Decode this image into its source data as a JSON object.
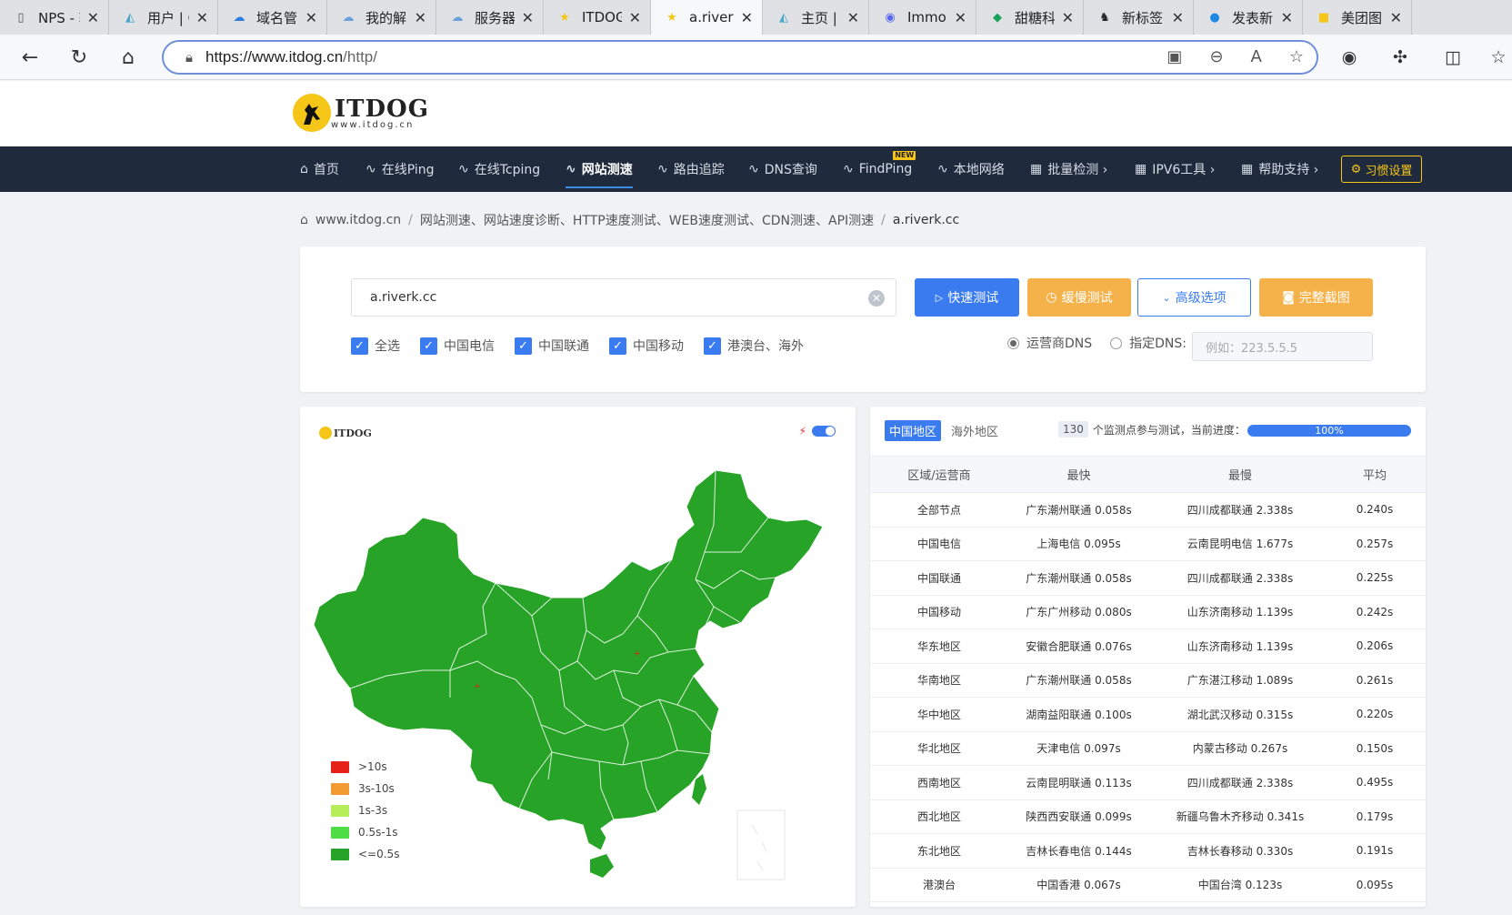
{
  "browser": {
    "tabs": [
      {
        "title": "NPS - 轻",
        "icon": "document-icon",
        "color": "#555"
      },
      {
        "title": "用户 | C",
        "icon": "triangle-icon",
        "color": "#4aa7c9"
      },
      {
        "title": "域名管",
        "icon": "cloud-icon",
        "color": "#2f7de1"
      },
      {
        "title": "我的解",
        "icon": "cloud-icon",
        "color": "#6aa0d8"
      },
      {
        "title": "服务器",
        "icon": "cloud-icon",
        "color": "#6aa0d8"
      },
      {
        "title": "ITDOG",
        "icon": "itdog-icon",
        "color": "#f5c518"
      },
      {
        "title": "a.riverk",
        "icon": "itdog-icon",
        "color": "#f5c518"
      },
      {
        "title": "主页 | A",
        "icon": "triangle-icon",
        "color": "#4aa7c9"
      },
      {
        "title": "Immor",
        "icon": "discord-icon",
        "color": "#5865f2"
      },
      {
        "title": "甜糖科",
        "icon": "sweet-icon",
        "color": "#1aa35a"
      },
      {
        "title": "新标签",
        "icon": "avatar-icon",
        "color": "#222"
      },
      {
        "title": "发表新",
        "icon": "chat-icon",
        "color": "#1e88e5"
      },
      {
        "title": "美团图",
        "icon": "meituan-icon",
        "color": "#f5c518"
      }
    ],
    "url_host": "https://www.itdog.cn",
    "url_path": "/http/"
  },
  "site": {
    "logo_text": "ITDOG",
    "logo_sub": "www.itdog.cn",
    "nav": [
      {
        "label": "首页",
        "icon": "⌂"
      },
      {
        "label": "在线Ping",
        "icon": "∿"
      },
      {
        "label": "在线Tcping",
        "icon": "∿"
      },
      {
        "label": "网站测速",
        "icon": "∿"
      },
      {
        "label": "路由追踪",
        "icon": "∿"
      },
      {
        "label": "DNS查询",
        "icon": "∿"
      },
      {
        "label": "FindPing",
        "icon": "∿",
        "badge": "NEW"
      },
      {
        "label": "本地网络",
        "icon": "∿"
      },
      {
        "label": "批量检测 ›",
        "icon": "▦"
      },
      {
        "label": "IPV6工具 ›",
        "icon": "▦"
      },
      {
        "label": "帮助支持 ›",
        "icon": "▦"
      }
    ],
    "settings_label": "习惯设置"
  },
  "breadcrumb": {
    "home": "www.itdog.cn",
    "section": "网站测速、网站速度诊断、HTTP速度测试、WEB速度测试、CDN测速、API测速",
    "current": "a.riverk.cc"
  },
  "test": {
    "domain": "a.riverk.cc",
    "buttons": {
      "quick": "快速测试",
      "slow": "缓慢测试",
      "advanced": "高级选项",
      "screenshot": "完整截图"
    },
    "checks": [
      "全选",
      "中国电信",
      "中国联通",
      "中国移动",
      "港澳台、海外"
    ],
    "dns_operator": "运营商DNS",
    "dns_custom": "指定DNS:",
    "dns_placeholder": "例如：223.5.5.5"
  },
  "map": {
    "logo": "ITDOG",
    "legend": [
      {
        "label": ">10s",
        "color": "#e62117"
      },
      {
        "label": "3s-10s",
        "color": "#f39a32"
      },
      {
        "label": "1s-3s",
        "color": "#b4ef5a"
      },
      {
        "label": "0.5s-1s",
        "color": "#4fdd45"
      },
      {
        "label": "<=0.5s",
        "color": "#27a327"
      }
    ],
    "fill_color": "#27a327"
  },
  "results": {
    "tab_china": "中国地区",
    "tab_overseas": "海外地区",
    "probe_count": "130",
    "probe_text": "个监测点参与测试，当前进度：",
    "progress_percent": 100,
    "progress_label": "100%",
    "headers": [
      "区域/运营商",
      "最快",
      "最慢",
      "平均"
    ],
    "rows": [
      [
        "全部节点",
        "广东潮州联通 0.058s",
        "四川成都联通 2.338s",
        "0.240s"
      ],
      [
        "中国电信",
        "上海电信 0.095s",
        "云南昆明电信 1.677s",
        "0.257s"
      ],
      [
        "中国联通",
        "广东潮州联通 0.058s",
        "四川成都联通 2.338s",
        "0.225s"
      ],
      [
        "中国移动",
        "广东广州移动 0.080s",
        "山东济南移动 1.139s",
        "0.242s"
      ],
      [
        "华东地区",
        "安徽合肥联通 0.076s",
        "山东济南移动 1.139s",
        "0.206s"
      ],
      [
        "华南地区",
        "广东潮州联通 0.058s",
        "广东湛江移动 1.089s",
        "0.261s"
      ],
      [
        "华中地区",
        "湖南益阳联通 0.100s",
        "湖北武汉移动 0.315s",
        "0.220s"
      ],
      [
        "华北地区",
        "天津电信 0.097s",
        "内蒙古移动 0.267s",
        "0.150s"
      ],
      [
        "西南地区",
        "云南昆明联通 0.113s",
        "四川成都联通 2.338s",
        "0.495s"
      ],
      [
        "西北地区",
        "陕西西安联通 0.099s",
        "新疆乌鲁木齐移动 0.341s",
        "0.179s"
      ],
      [
        "东北地区",
        "吉林长春电信 0.144s",
        "吉林长春移动 0.330s",
        "0.191s"
      ],
      [
        "港澳台",
        "中国香港 0.067s",
        "中国台湾 0.123s",
        "0.095s"
      ]
    ]
  }
}
